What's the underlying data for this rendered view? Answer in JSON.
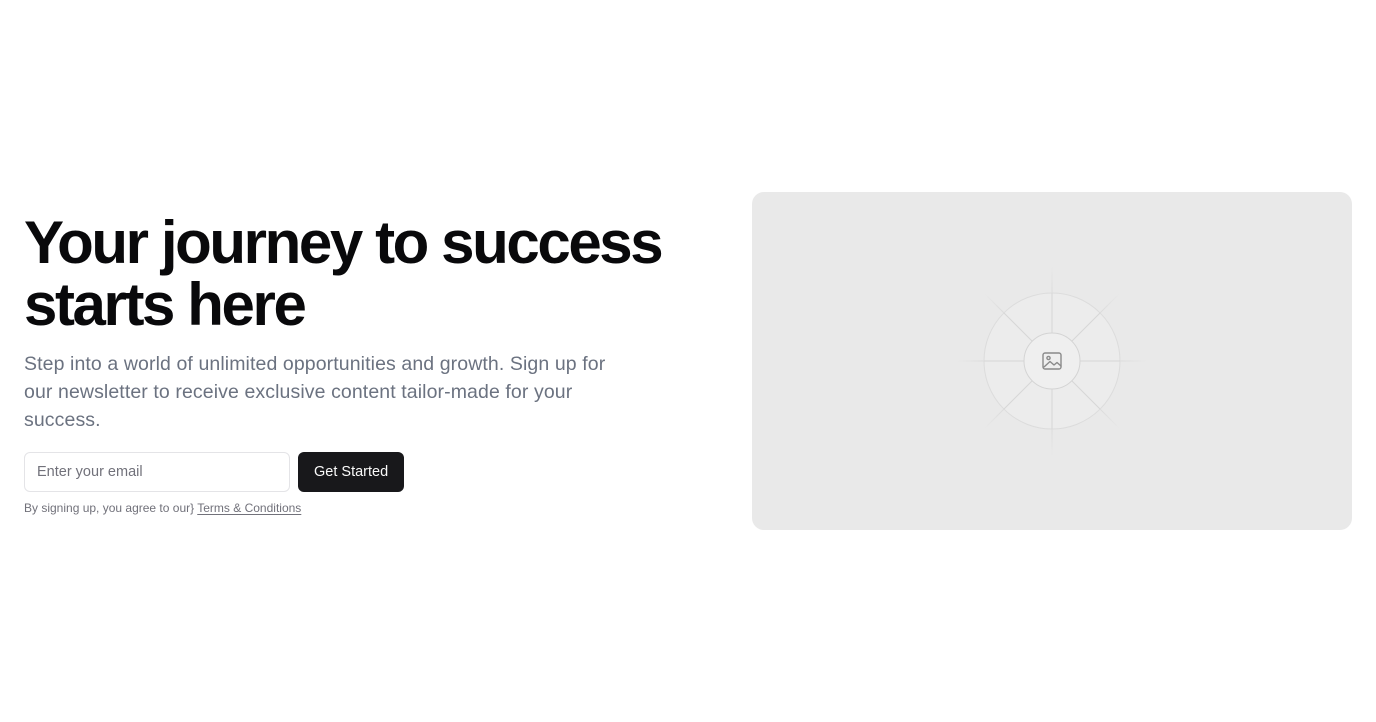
{
  "hero": {
    "headline_line1": "Your journey to success",
    "headline_line2": "starts here",
    "subtitle": "Step into a world of unlimited opportunities and growth. Sign up for our newsletter to receive exclusive content tailor-made for your success."
  },
  "form": {
    "email_placeholder": "Enter your email",
    "email_value": "",
    "submit_label": "Get Started"
  },
  "legal": {
    "prefix": "By signing up, you agree to our}",
    "link_label": "Terms & Conditions"
  },
  "media": {
    "icon": "image-placeholder-icon"
  }
}
